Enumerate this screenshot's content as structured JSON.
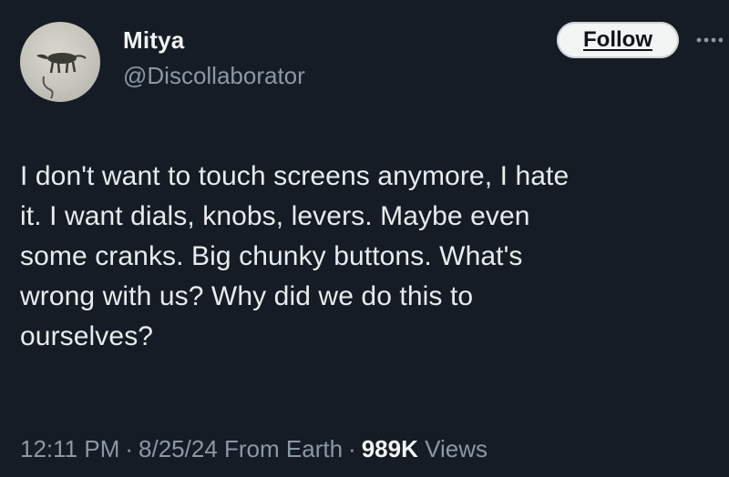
{
  "author": {
    "display_name": "Mitya",
    "handle": "@Discollaborator"
  },
  "actions": {
    "follow_label": "Follow",
    "more_icon": "more-horizontal-icon"
  },
  "tweet": {
    "lines": [
      "I don't want to touch screens anymore, I hate",
      "it. I want dials, knobs, levers. Maybe even",
      "some cranks. Big chunky buttons. What's",
      "wrong with us? Why did we do this to",
      "ourselves?"
    ]
  },
  "meta": {
    "time": "12:11 PM",
    "separator": "·",
    "date": "8/25/24",
    "source": "From Earth",
    "views_count": "989K",
    "views_label": "Views"
  },
  "colors": {
    "background": "#151c25",
    "primary_text": "#e9ebec",
    "secondary_text": "#8b98a5",
    "follow_bg": "#f3f4f4"
  }
}
